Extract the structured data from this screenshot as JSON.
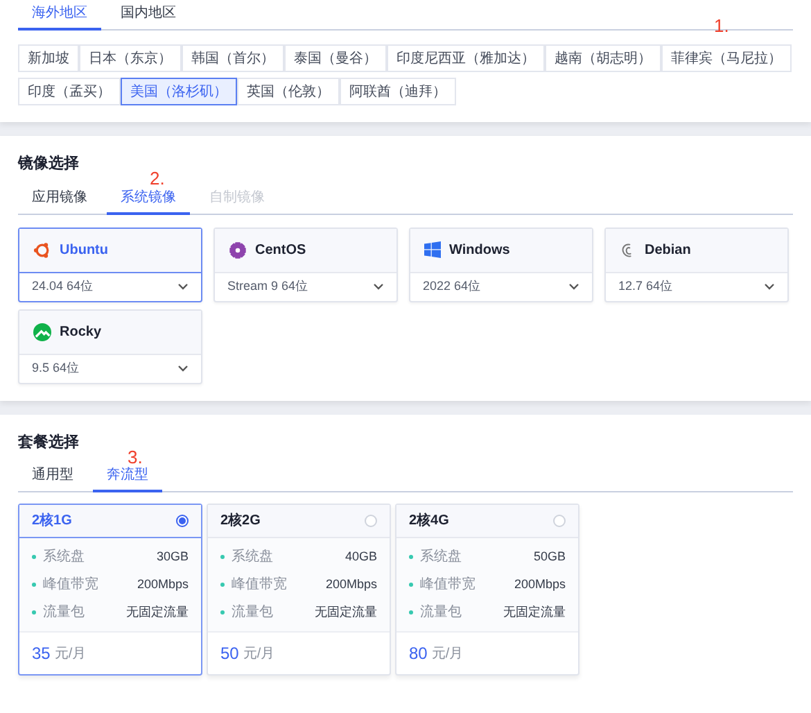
{
  "region": {
    "tabs": [
      {
        "label": "海外地区",
        "selected": true
      },
      {
        "label": "国内地区",
        "selected": false
      }
    ],
    "annotation": "1.",
    "options": [
      {
        "label": "新加坡",
        "selected": false
      },
      {
        "label": "日本（东京）",
        "selected": false
      },
      {
        "label": "韩国（首尔）",
        "selected": false
      },
      {
        "label": "泰国（曼谷）",
        "selected": false
      },
      {
        "label": "印度尼西亚（雅加达）",
        "selected": false
      },
      {
        "label": "越南（胡志明）",
        "selected": false
      },
      {
        "label": "菲律宾（马尼拉）",
        "selected": false
      },
      {
        "label": "印度（孟买）",
        "selected": false
      },
      {
        "label": "美国（洛杉矶）",
        "selected": true
      },
      {
        "label": "英国（伦敦）",
        "selected": false
      },
      {
        "label": "阿联酋（迪拜）",
        "selected": false
      }
    ]
  },
  "image": {
    "title": "镜像选择",
    "annotation": "2.",
    "tabs": [
      {
        "label": "应用镜像",
        "selected": false,
        "disabled": false
      },
      {
        "label": "系统镜像",
        "selected": true,
        "disabled": false
      },
      {
        "label": "自制镜像",
        "selected": false,
        "disabled": true
      }
    ],
    "systems": [
      {
        "kind": "ubuntu",
        "name": "Ubuntu",
        "version": "24.04 64位",
        "selected": true
      },
      {
        "kind": "centos",
        "name": "CentOS",
        "version": "Stream 9 64位",
        "selected": false
      },
      {
        "kind": "windows",
        "name": "Windows",
        "version": "2022 64位",
        "selected": false
      },
      {
        "kind": "debian",
        "name": "Debian",
        "version": "12.7 64位",
        "selected": false
      },
      {
        "kind": "rocky",
        "name": "Rocky",
        "version": "9.5 64位",
        "selected": false
      }
    ]
  },
  "plan": {
    "title": "套餐选择",
    "annotation": "3.",
    "tabs": [
      {
        "label": "通用型",
        "selected": false
      },
      {
        "label": "奔流型",
        "selected": true
      }
    ],
    "plans": [
      {
        "name": "2核1G",
        "selected": true,
        "specs": [
          {
            "label": "系统盘",
            "value": "30GB"
          },
          {
            "label": "峰值带宽",
            "value": "200Mbps"
          },
          {
            "label": "流量包",
            "value": "无固定流量"
          }
        ],
        "price": "35",
        "unit": "元/月"
      },
      {
        "name": "2核2G",
        "selected": false,
        "specs": [
          {
            "label": "系统盘",
            "value": "40GB"
          },
          {
            "label": "峰值带宽",
            "value": "200Mbps"
          },
          {
            "label": "流量包",
            "value": "无固定流量"
          }
        ],
        "price": "50",
        "unit": "元/月"
      },
      {
        "name": "2核4G",
        "selected": false,
        "specs": [
          {
            "label": "系统盘",
            "value": "50GB"
          },
          {
            "label": "峰值带宽",
            "value": "200Mbps"
          },
          {
            "label": "流量包",
            "value": "无固定流量"
          }
        ],
        "price": "80",
        "unit": "元/月"
      }
    ]
  }
}
